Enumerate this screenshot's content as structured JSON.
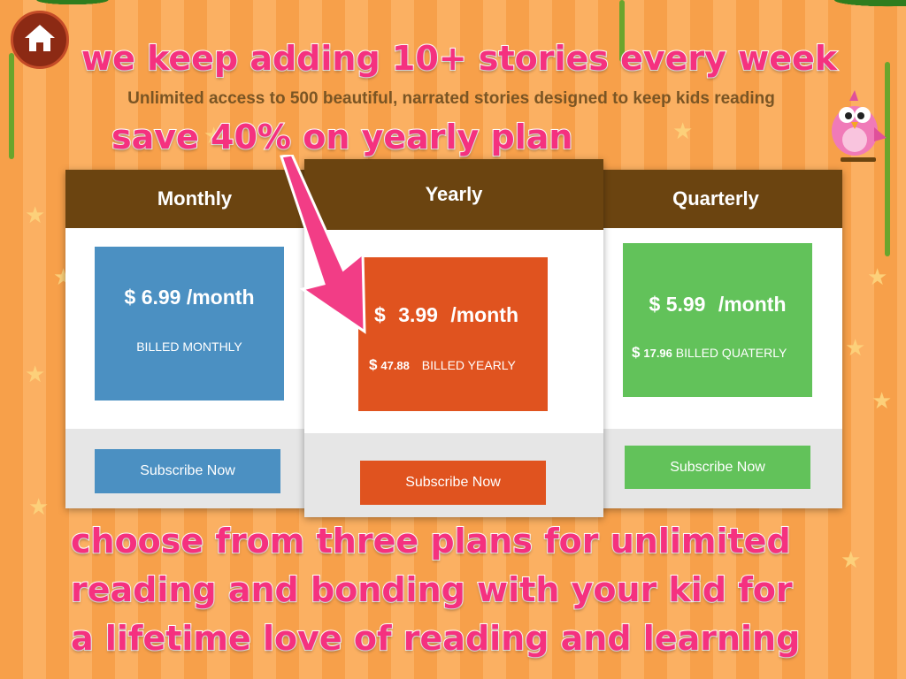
{
  "promo": {
    "top": "we keep adding 10+ stories every week",
    "save": "save 40% on yearly plan",
    "bottom_lines": [
      "choose from three plans for unlimited",
      "reading and bonding with your kid for",
      "a lifetime love of reading and learning"
    ]
  },
  "subtitle": "Unlimited access to 500 beautiful, narrated stories designed to keep kids reading",
  "plans": {
    "monthly": {
      "title": "Monthly",
      "currency": "$",
      "price": "6.99",
      "per": "/month",
      "billed": "BILLED MONTHLY",
      "button": "Subscribe Now",
      "color": "#4b90c2"
    },
    "yearly": {
      "title": "Yearly",
      "currency": "$",
      "price": "3.99",
      "per": "/month",
      "billed_amount": "47.88",
      "billed": "BILLED YEARLY",
      "button": "Subscribe Now",
      "color": "#e0531f"
    },
    "quarterly": {
      "title": "Quarterly",
      "currency": "$",
      "price": "5.99",
      "per": "/month",
      "billed_amount": "17.96",
      "billed": "BILLED QUATERLY",
      "button": "Subscribe Now",
      "color": "#62c25a"
    }
  },
  "colors": {
    "header_brown": "#6b4410",
    "promo_pink": "#f5317f",
    "arrow_pink": "#f23d86"
  },
  "icons": [
    "home-icon",
    "bird-mascot-icon",
    "arrow-icon"
  ]
}
